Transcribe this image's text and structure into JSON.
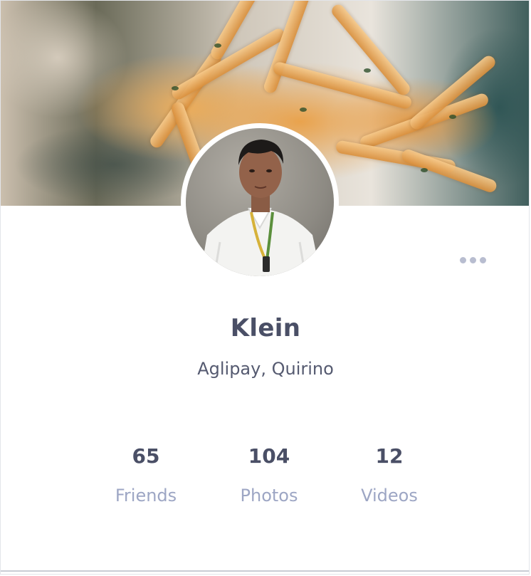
{
  "profile": {
    "name": "Klein",
    "location": "Aglipay, Quirino"
  },
  "stats": [
    {
      "value": "65",
      "label": "Friends"
    },
    {
      "value": "104",
      "label": "Photos"
    },
    {
      "value": "12",
      "label": "Videos"
    }
  ],
  "icons": {
    "more": "more-horizontal-icon"
  },
  "colors": {
    "text_primary": "#4a4f66",
    "text_muted": "#9da6c4",
    "dots": "#b8bdd0"
  }
}
